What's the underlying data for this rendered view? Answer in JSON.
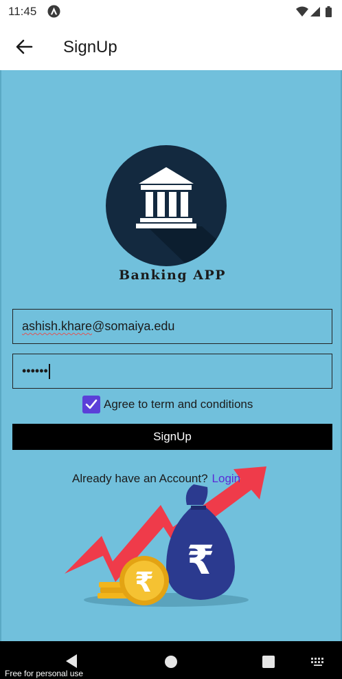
{
  "status_bar": {
    "time": "11:45",
    "icons": [
      "app-notification-icon",
      "wifi-icon",
      "signal-icon",
      "battery-icon"
    ]
  },
  "app_bar": {
    "title": "SignUp",
    "back_icon": "arrow-left-icon"
  },
  "logo": {
    "icon": "bank-building-icon",
    "brand_text": "Banking APP"
  },
  "form": {
    "email_value_part1": "ashish.khare",
    "email_value_part2": "@somaiya.edu",
    "password_masked": "••••••",
    "agree_checked": true,
    "agree_label": "Agree to term and conditions",
    "signup_button": "SignUp"
  },
  "account_prompt": {
    "text": "Already have an Account?",
    "login_link": "Login"
  },
  "nav_bar": {
    "icons": [
      "back-triangle-icon",
      "home-circle-icon",
      "recents-square-icon",
      "keyboard-icon"
    ]
  },
  "watermark": "Free for personal use",
  "colors": {
    "content_bg": "#71c0dc",
    "logo_circle": "#13293f",
    "checkbox": "#5b3fd8",
    "link": "#5b2bd6",
    "button_bg": "#000000",
    "arrow_red": "#ef3b4a",
    "bag_blue": "#2b3a8f",
    "coin_gold": "#f2b51c"
  }
}
